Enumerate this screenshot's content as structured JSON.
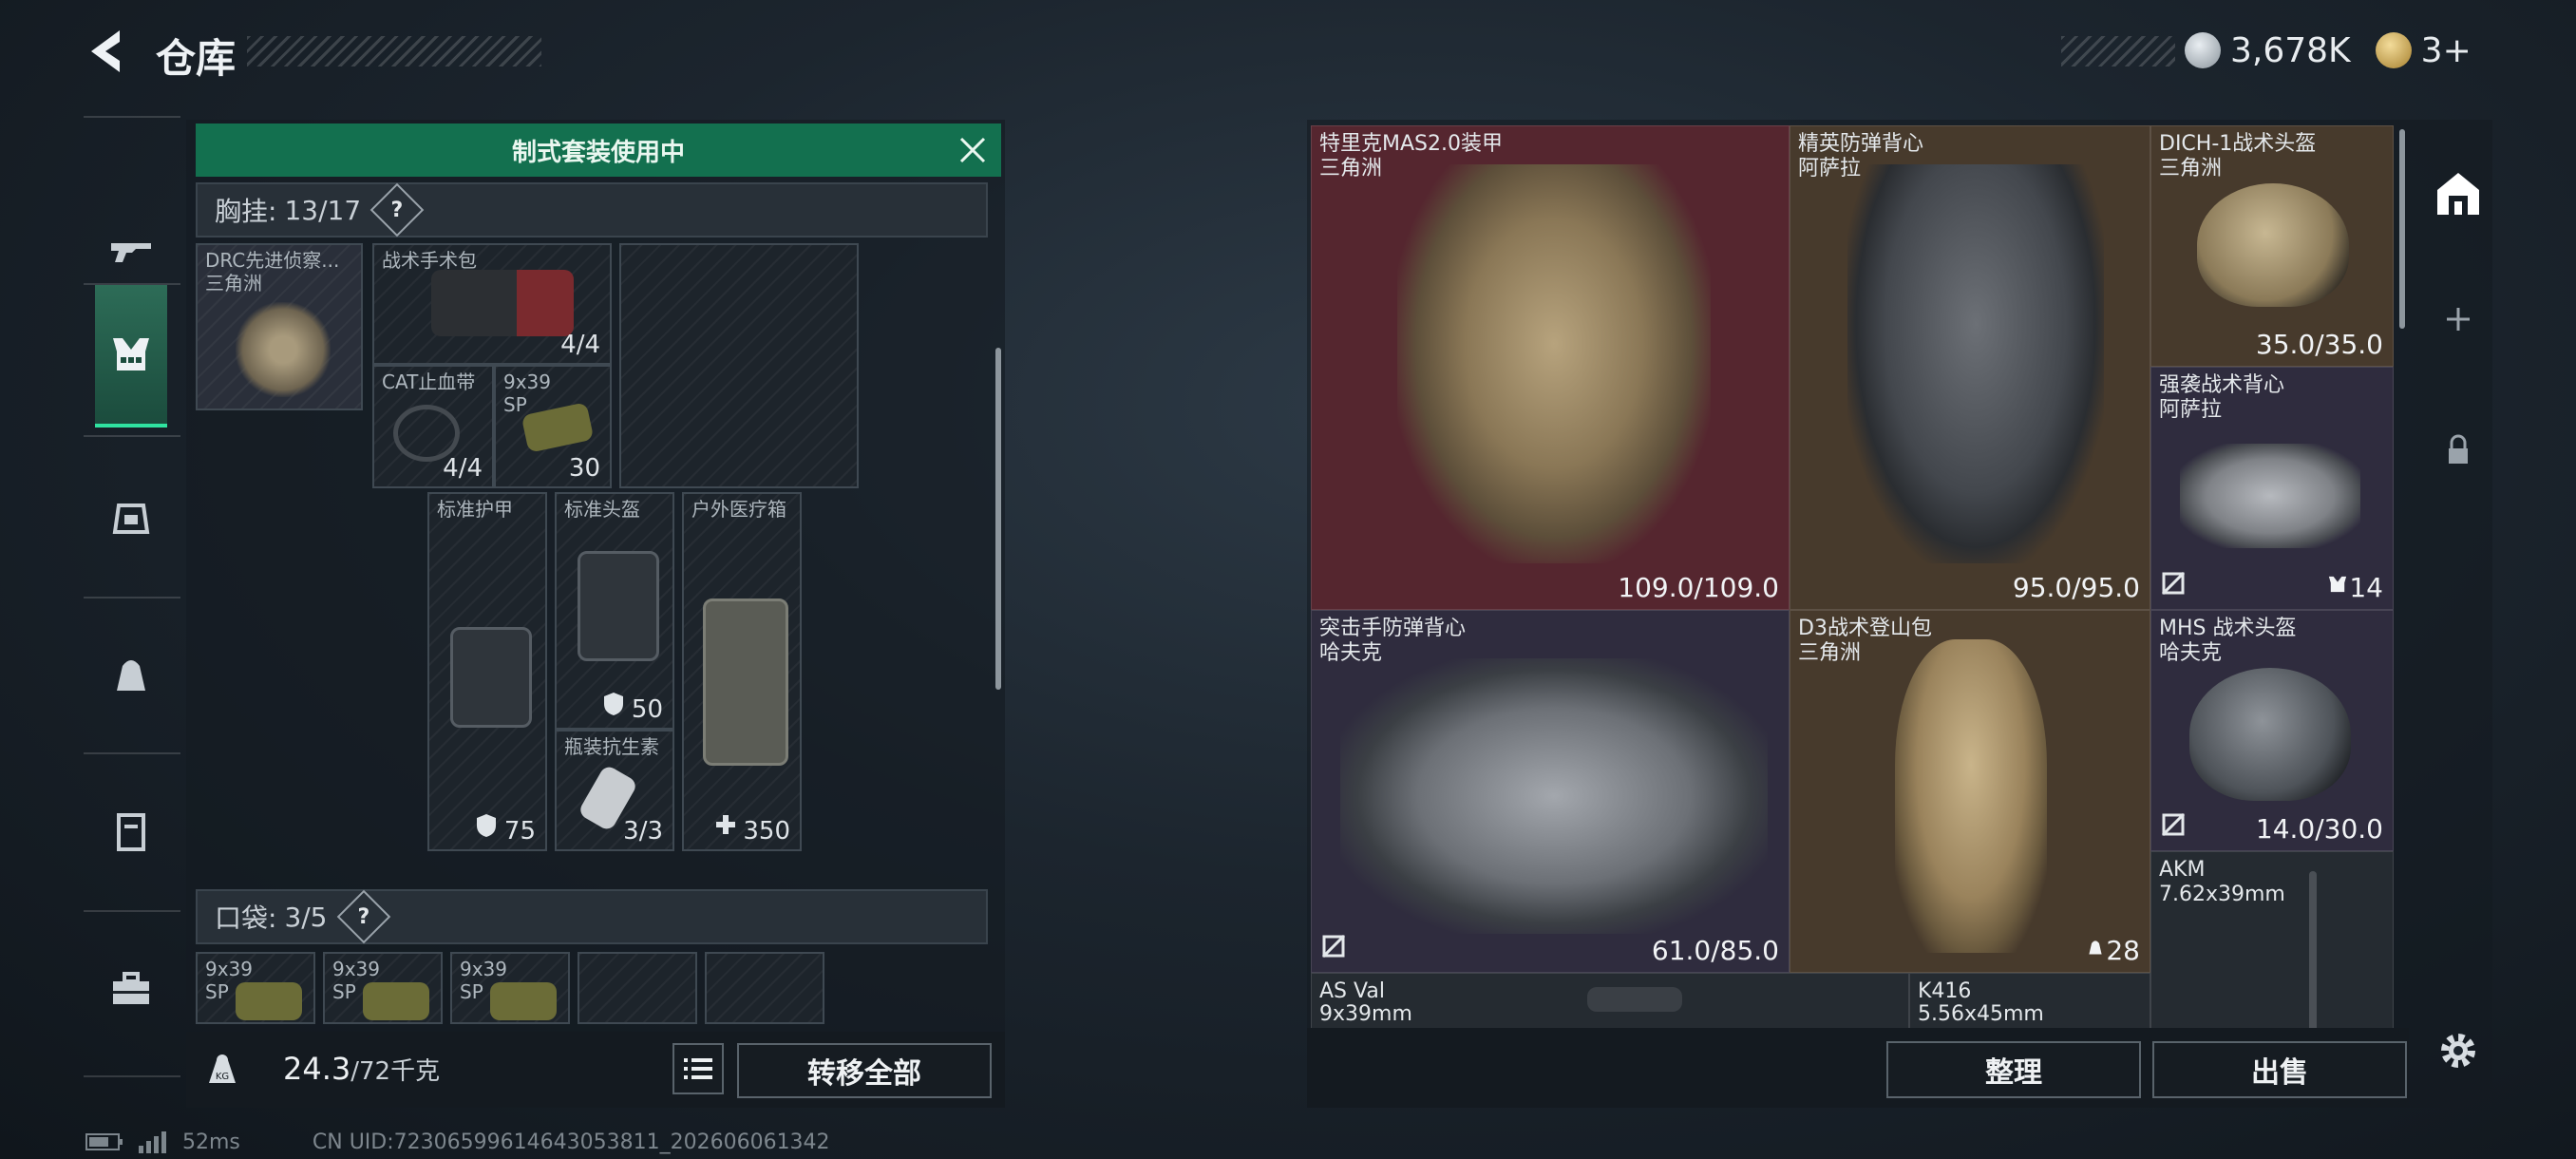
{
  "header": {
    "title": "仓库",
    "currency_amount": "3,678K",
    "second_currency": "3+"
  },
  "sidebar": {
    "items": [
      {
        "icon": "rifle-icon"
      },
      {
        "icon": "chest-rig-icon",
        "active": true
      },
      {
        "icon": "backpack-icon"
      },
      {
        "icon": "bag-icon"
      },
      {
        "icon": "locker-icon"
      },
      {
        "icon": "toolbox-icon"
      }
    ]
  },
  "loadout": {
    "banner": "制式套装使用中",
    "chest_rig": {
      "label": "胸挂:",
      "count": "13/17",
      "help": "?"
    },
    "rig_item": {
      "name": "DRC先进侦察...",
      "maker": "三角洲"
    },
    "slots": [
      {
        "name": "战术手术包",
        "value": "4/4"
      },
      {
        "name": "CAT止血带",
        "value": "4/4"
      },
      {
        "name": "9x39 SP",
        "value": "30"
      },
      {
        "name": "标准护甲",
        "value": "75"
      },
      {
        "name": "标准头盔",
        "value": "50"
      },
      {
        "name": "瓶装抗生素",
        "value": "3/3"
      },
      {
        "name": "户外医疗箱",
        "value": "350"
      }
    ],
    "pockets": {
      "label": "口袋:",
      "count": "3/5",
      "help": "?"
    },
    "pocket_items": [
      "9x39 SP",
      "9x39 SP",
      "9x39 SP"
    ],
    "weight": "24.3",
    "weight_max": "/72千克",
    "transfer_all": "转移全部"
  },
  "storage": {
    "items": [
      {
        "name": "特里克MAS2.0装甲",
        "maker": "三角洲",
        "value": "109.0/109.0"
      },
      {
        "name": "精英防弹背心",
        "maker": "阿萨拉",
        "value": "95.0/95.0"
      },
      {
        "name": "DICH-1战术头盔",
        "maker": "三角洲",
        "value": "35.0/35.0"
      },
      {
        "name": "强袭战术背心",
        "maker": "阿萨拉",
        "value": "14"
      },
      {
        "name": "突击手防弹背心",
        "maker": "哈夫克",
        "value": "61.0/85.0"
      },
      {
        "name": "D3战术登山包",
        "maker": "三角洲",
        "value": "28"
      },
      {
        "name": "MHS 战术头盔",
        "maker": "哈夫克",
        "value": "14.0/30.0"
      },
      {
        "name": "AKM",
        "maker": "7.62x39mm",
        "value": ""
      },
      {
        "name": "AS Val",
        "maker": "9x39mm",
        "value": ""
      },
      {
        "name": "K416",
        "maker": "5.56x45mm",
        "value": ""
      }
    ],
    "sort_button": "整理",
    "sell_button": "出售"
  },
  "status": {
    "ping": "52ms",
    "uid": "CN UID:72306599614643053811_202606061342"
  },
  "colors": {
    "banner_green": "#13704f",
    "red_rarity": "#5a2530",
    "gold_rarity": "#4a3a2b",
    "purple_rarity": "#2f2c3e"
  }
}
